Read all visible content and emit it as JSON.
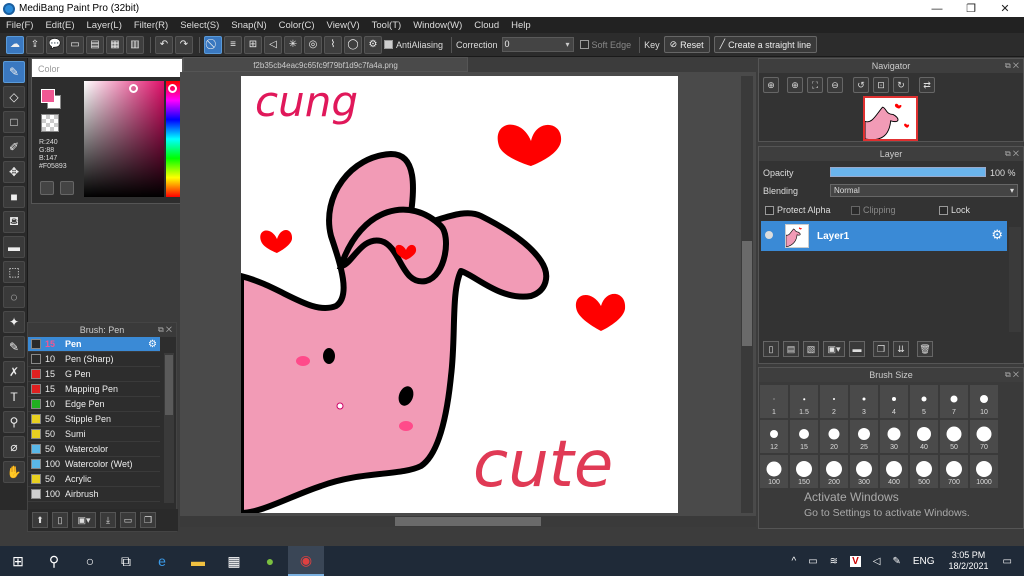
{
  "window": {
    "title": "MediBang Paint Pro (32bit)",
    "minimize": "—",
    "maximize": "❐",
    "close": "✕"
  },
  "menu": [
    "File(F)",
    "Edit(E)",
    "Layer(L)",
    "Filter(R)",
    "Select(S)",
    "Snap(N)",
    "Color(C)",
    "View(V)",
    "Tool(T)",
    "Window(W)",
    "Cloud",
    "Help"
  ],
  "toolbar": {
    "antialiasing_label": "AntiAliasing",
    "correction_label": "Correction",
    "correction_value": "0",
    "soft_edge_label": "Soft Edge",
    "key_label": "Key",
    "reset_label": "Reset",
    "straight_line_label": "Create a straight line"
  },
  "color_panel": {
    "title": "Color",
    "r": "R:240",
    "g": "G:88",
    "b": "B:147",
    "hex": "#F05893",
    "foreground": "#F05893",
    "background": "#FFFFFF"
  },
  "document": {
    "tab": "f2b35cb4eac9c65fc9f79bf1d9c7fa4a.png"
  },
  "canvas_text": {
    "top": "cung",
    "bottom": "cute"
  },
  "brush_panel": {
    "title": "Brush: Pen",
    "items": [
      {
        "size": "15",
        "name": "Pen",
        "color": "#2a2a2a"
      },
      {
        "size": "10",
        "name": "Pen (Sharp)",
        "color": "#2a2a2a"
      },
      {
        "size": "15",
        "name": "G Pen",
        "color": "#e02020"
      },
      {
        "size": "15",
        "name": "Mapping Pen",
        "color": "#e02020"
      },
      {
        "size": "10",
        "name": "Edge Pen",
        "color": "#20b020"
      },
      {
        "size": "50",
        "name": "Stipple Pen",
        "color": "#e8d020"
      },
      {
        "size": "50",
        "name": "Sumi",
        "color": "#e8d020"
      },
      {
        "size": "50",
        "name": "Watercolor",
        "color": "#5ab8e8"
      },
      {
        "size": "100",
        "name": "Watercolor (Wet)",
        "color": "#5ab8e8"
      },
      {
        "size": "50",
        "name": "Acrylic",
        "color": "#e8d020"
      },
      {
        "size": "100",
        "name": "Airbrush",
        "color": "#d0d0d0"
      }
    ]
  },
  "navigator": {
    "title": "Navigator"
  },
  "layer_panel": {
    "title": "Layer",
    "opacity_label": "Opacity",
    "opacity_value": "100 %",
    "opacity_fraction": 1.0,
    "blending_label": "Blending",
    "blending_value": "Normal",
    "protect_alpha_label": "Protect Alpha",
    "clipping_label": "Clipping",
    "lock_label": "Lock",
    "layer_name": "Layer1"
  },
  "brush_size": {
    "title": "Brush Size",
    "sizes": [
      "1",
      "1.5",
      "2",
      "3",
      "4",
      "5",
      "7",
      "10",
      "12",
      "15",
      "20",
      "25",
      "30",
      "40",
      "50",
      "70",
      "100",
      "150",
      "200",
      "300",
      "400",
      "500",
      "700",
      "1000"
    ]
  },
  "watermark": {
    "line1": "Activate Windows",
    "line2": "Go to Settings to activate Windows."
  },
  "taskbar": {
    "lang": "ENG",
    "time": "3:05 PM",
    "date": "18/2/2021"
  }
}
